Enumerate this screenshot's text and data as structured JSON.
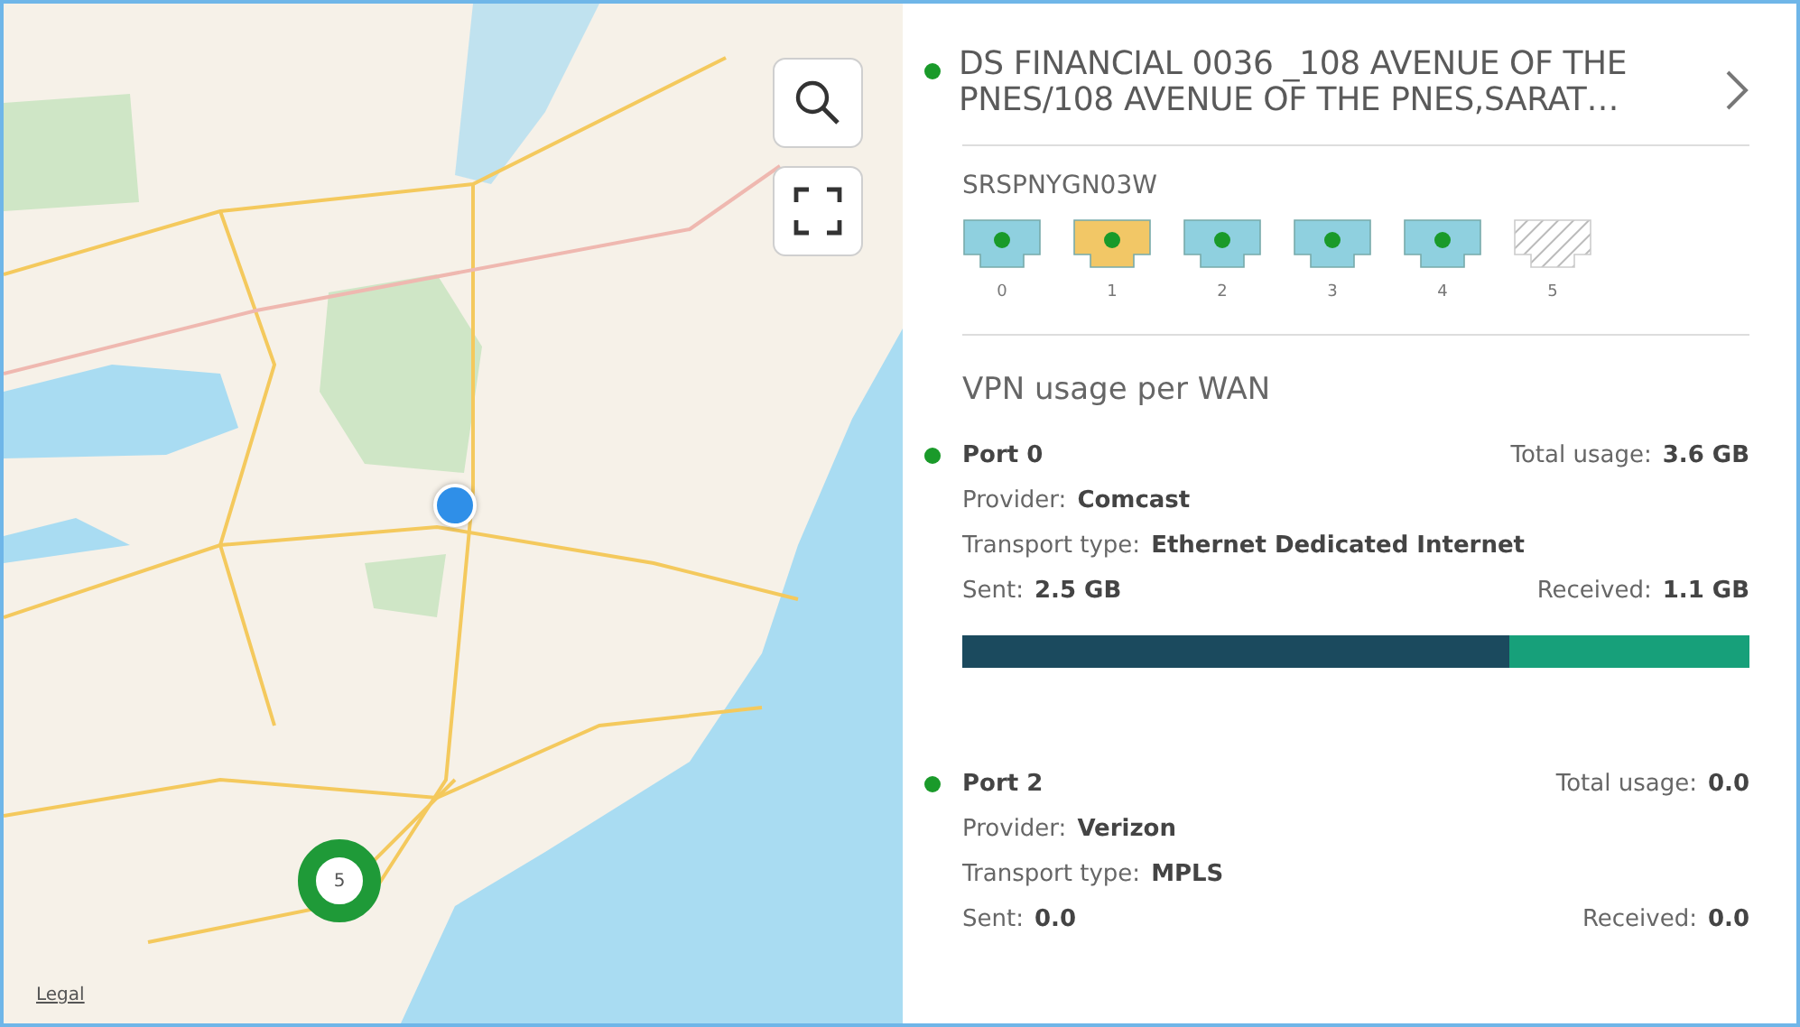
{
  "map": {
    "kind": "picture",
    "legal_link": "Legal",
    "cluster": {
      "count": "5"
    },
    "buttons": [
      {
        "kind": "search"
      },
      {
        "kind": "fullscreen"
      }
    ]
  },
  "site": {
    "color": "#1a9a2a",
    "title": "DS FINANCIAL 0036 _108 AVENUE OF THE PNES/108 AVENUE OF THE PNES,SARAT…"
  },
  "device": {
    "name": "SRSPNYGN03W",
    "ports": [
      {
        "label": "0",
        "kind": "active",
        "color": "#8fd0df"
      },
      {
        "label": "1",
        "kind": "active",
        "color": "#f2c766"
      },
      {
        "label": "2",
        "kind": "active",
        "color": "#8fd0df"
      },
      {
        "label": "3",
        "kind": "active",
        "color": "#8fd0df"
      },
      {
        "label": "4",
        "kind": "active",
        "color": "#8fd0df"
      },
      {
        "label": "5",
        "kind": "unused"
      }
    ]
  },
  "wan_usage": {
    "title": "VPN usage per WAN",
    "ports": [
      {
        "name": "Port 0",
        "color": "#1a9a2a",
        "total_label": "Total usage:",
        "total": "3.6 GB",
        "provider_label": "Provider:",
        "provider": "Comcast",
        "transport_label": "Transport type:",
        "transport": "Ethernet Dedicated Internet",
        "sent_label": "Sent:",
        "sent": "2.5 GB",
        "received_label": "Received:",
        "received": "1.1 GB",
        "usage_bar": {
          "level": 0.695
        }
      },
      {
        "name": "Port 2",
        "color": "#1a9a2a",
        "total_label": "Total usage:",
        "total": "0.0",
        "provider_label": "Provider:",
        "provider": "Verizon",
        "transport_label": "Transport type:",
        "transport": "MPLS",
        "sent_label": "Sent:",
        "sent": "0.0",
        "received_label": "Received:",
        "received": "0.0"
      }
    ]
  }
}
